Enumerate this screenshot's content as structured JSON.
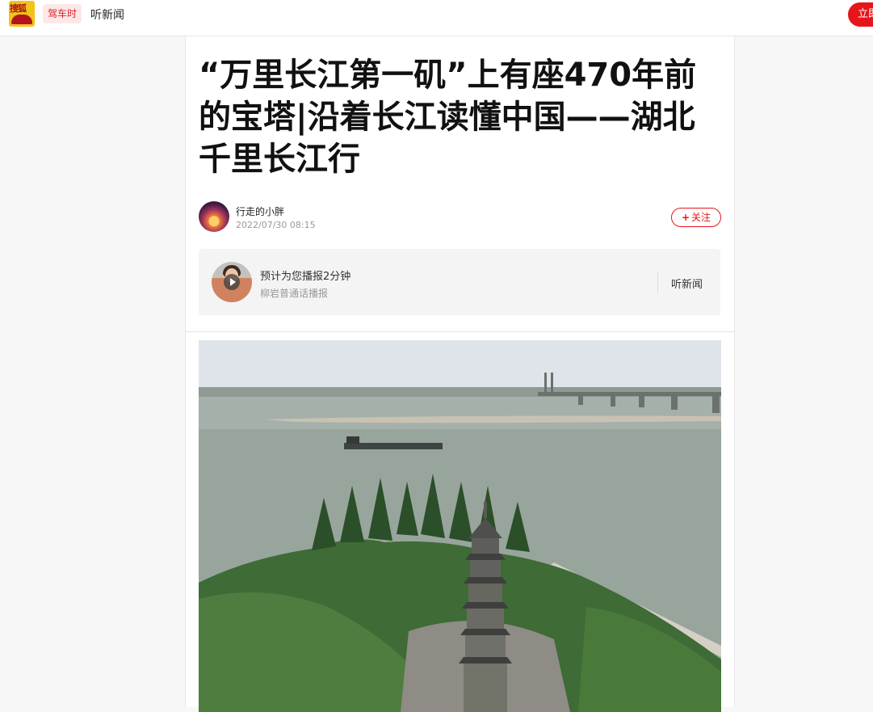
{
  "header": {
    "logo_text": "搜狐",
    "tag": "驾车时",
    "listen_news": "听新闻",
    "login_button": "立即"
  },
  "article": {
    "title": "“万里长江第一矶”上有座470年前的宝塔|沿着长江读懂中国——湖北千里长江行",
    "author": {
      "name": "行走的小胖",
      "time": "2022/07/30 08:15"
    },
    "follow_label": "关注",
    "audio": {
      "title": "预计为您播报2分钟",
      "narrator": "柳岩普通话播报",
      "listen_label": "听新闻"
    }
  },
  "colors": {
    "brand_red": "#e6141b",
    "logo_yellow": "#f2c318"
  },
  "icons": [
    "sohu-logo-icon",
    "play-icon",
    "plus-icon"
  ]
}
